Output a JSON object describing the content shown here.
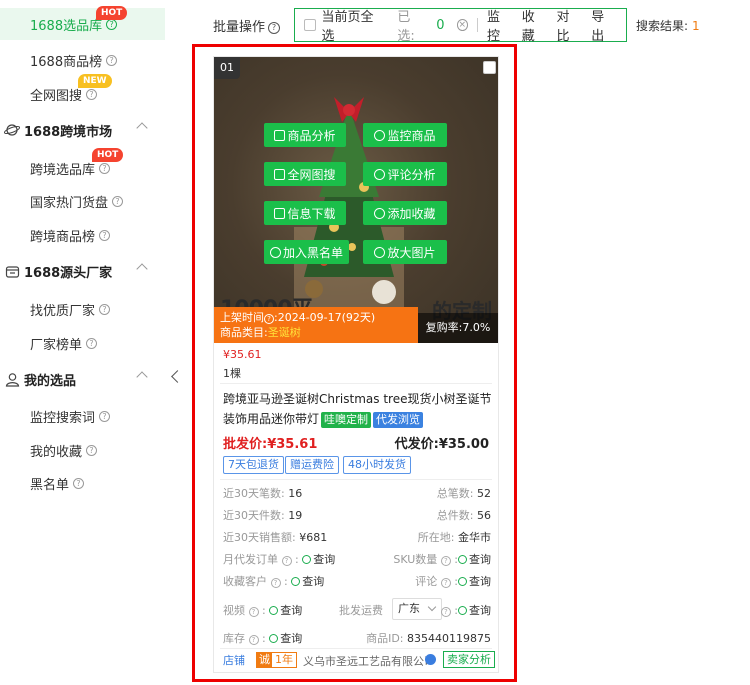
{
  "sidebar": {
    "items": [
      {
        "label": "1688选品库",
        "badge": "HOT",
        "active": true
      },
      {
        "label": "1688商品榜"
      },
      {
        "label": "全网图搜",
        "badge": "NEW"
      }
    ],
    "groups": [
      {
        "label": "1688跨境市场",
        "icon": "globe-icon",
        "items": [
          {
            "label": "跨境选品库",
            "badge": "HOT"
          },
          {
            "label": "国家热门货盘"
          },
          {
            "label": "跨境商品榜"
          }
        ]
      },
      {
        "label": "1688源头厂家",
        "icon": "factory-icon",
        "items": [
          {
            "label": "找优质厂家"
          },
          {
            "label": "厂家榜单"
          }
        ]
      },
      {
        "label": "我的选品",
        "icon": "user-icon",
        "items": [
          {
            "label": "监控搜索词"
          },
          {
            "label": "我的收藏"
          },
          {
            "label": "黑名单"
          }
        ]
      }
    ]
  },
  "toolbar": {
    "batch_label": "批量操作",
    "select_all": "当前页全选",
    "selected_label": "已选:",
    "selected_count": "0",
    "actions": [
      "监控",
      "收藏",
      "对比",
      "导出"
    ],
    "result_label": "搜索结果:",
    "result_count": "1"
  },
  "card": {
    "rank": "01",
    "overlay_buttons": [
      "商品分析",
      "监控商品",
      "全网图搜",
      "评论分析",
      "信息下载",
      "添加收藏",
      "加入黑名单",
      "放大图片"
    ],
    "image_text_left": "10000平",
    "image_text_right": "的定制",
    "listing_label": "上架时间",
    "listing_value": ":2024-09-17(92天)",
    "category_label": "商品类目:",
    "category_value": "圣诞树",
    "repurchase": "复购率:7.0%",
    "price_small": "¥35.61",
    "unit": "1棵",
    "title": "跨境亚马逊圣诞树Christmas tree现货小树圣诞节装饰用品迷你带灯",
    "tag_custom": "哇噢定制",
    "tag_dropship": "代发浏览",
    "wholesale_price": "批发价:¥35.61",
    "dropship_price": "代发价:¥35.00",
    "services": [
      "7天包退货",
      "赠运费险",
      "48小时发货"
    ],
    "stats": {
      "orders_30d_label": "近30天笔数:",
      "orders_30d": "16",
      "total_orders_label": "总笔数:",
      "total_orders": "52",
      "pieces_30d_label": "近30天件数:",
      "pieces_30d": "19",
      "total_pieces_label": "总件数:",
      "total_pieces": "56",
      "sales_30d_label": "近30天销售额:",
      "sales_30d": "¥681",
      "location_label": "所在地:",
      "location": "金华市",
      "monthly_dropship_label": "月代发订单",
      "query": "查询",
      "sku_label": "SKU数量",
      "fav_label": "收藏客户",
      "review_label": "评论",
      "video_label": "视频",
      "freight_label": "批发运费",
      "region": "广东",
      "stock_label": "库存",
      "product_id_label": "商品ID:",
      "product_id": "835440119875"
    },
    "shop_tag": "店铺",
    "years_icon": "诚",
    "years": "1年",
    "shop_name": "义乌市圣远工艺品有限公司",
    "seller_analysis": "卖家分析"
  }
}
